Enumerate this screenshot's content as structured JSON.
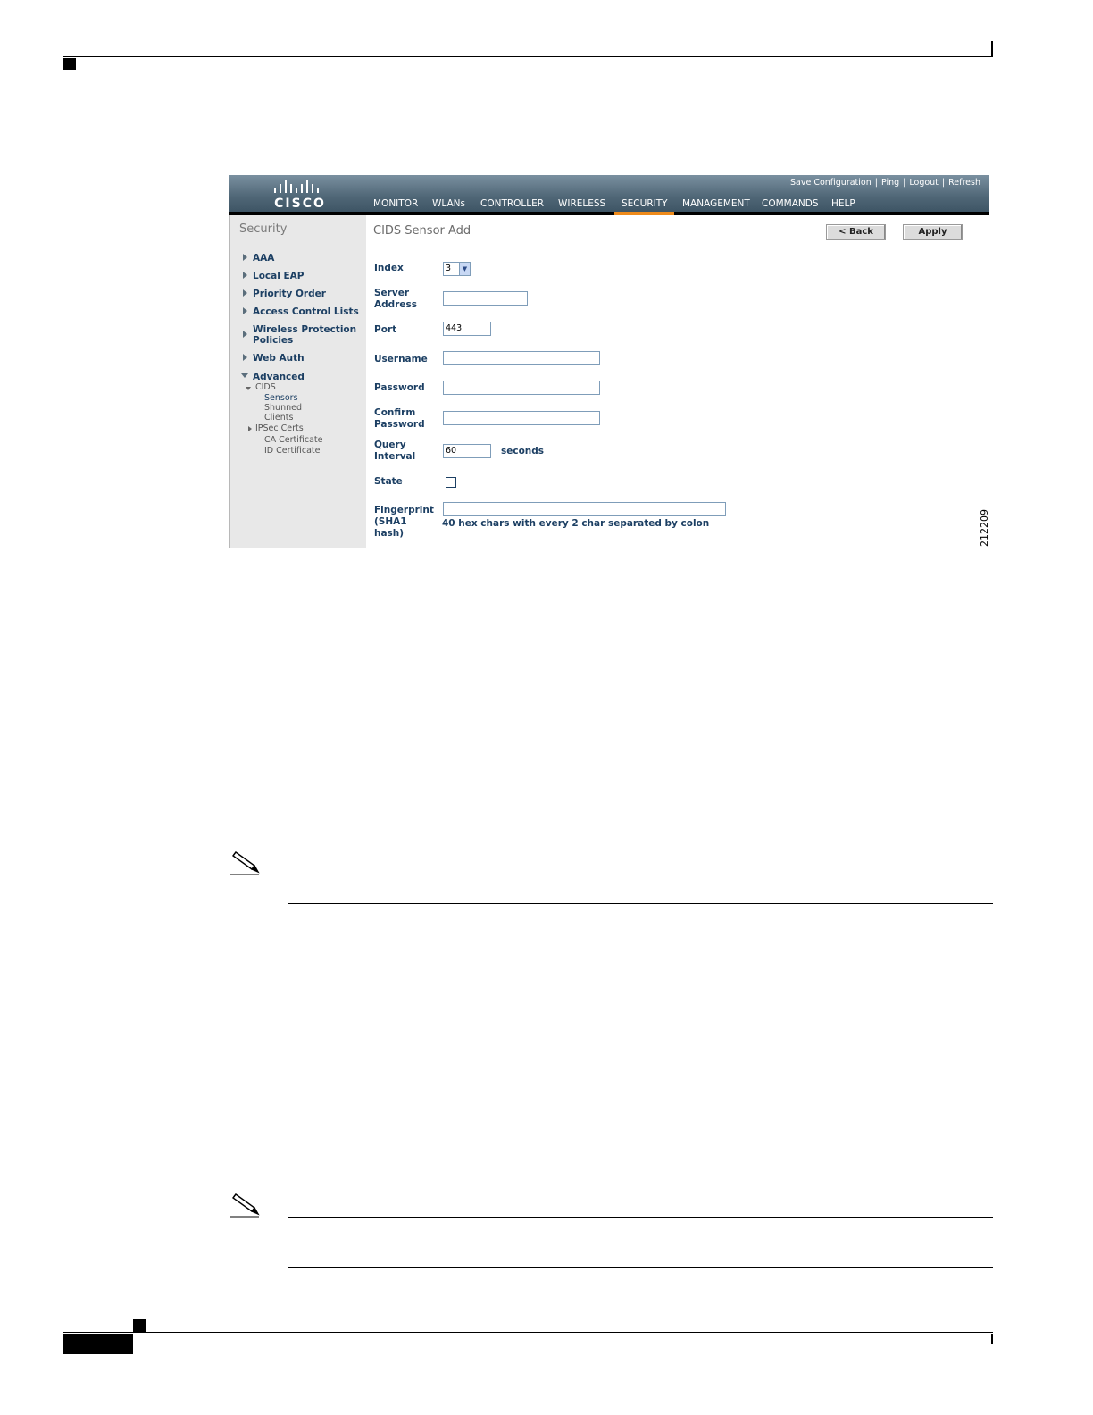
{
  "figure_id": "212209",
  "screenshot": {
    "utility_links": [
      "Save Configuration",
      "Ping",
      "Logout",
      "Refresh"
    ],
    "logo_text": "CISCO",
    "nav": [
      "MONITOR",
      "WLANs",
      "CONTROLLER",
      "WIRELESS",
      "SECURITY",
      "MANAGEMENT",
      "COMMANDS",
      "HELP"
    ],
    "active_nav": "SECURITY",
    "colors": {
      "accent": "#ee8a1a",
      "header": "#4f6676",
      "link": "#1c3f63"
    },
    "sidebar": {
      "title": "Security",
      "items": [
        "AAA",
        "Local EAP",
        "Priority Order",
        "Access Control Lists",
        "Wireless Protection",
        "Policies",
        "Web Auth",
        "Advanced"
      ],
      "sub_cids": "CIDS",
      "sub_cids_items": [
        "Sensors",
        "Shunned",
        "Clients"
      ],
      "sub_ipsec": "IPSec Certs",
      "sub_ipsec_items": [
        "CA Certificate",
        "ID Certificate"
      ]
    },
    "page_title": "CIDS Sensor Add",
    "buttons": {
      "back": "< Back",
      "apply": "Apply"
    },
    "form": {
      "index_label": "Index",
      "index_value": "3",
      "server_label_1": "Server",
      "server_label_2": "Address",
      "server_value": "",
      "port_label": "Port",
      "port_value": "443",
      "username_label": "Username",
      "username_value": "",
      "password_label": "Password",
      "password_value": "",
      "confirm_label_1": "Confirm",
      "confirm_label_2": "Password",
      "confirm_value": "",
      "query_label_1": "Query",
      "query_label_2": "Interval",
      "query_value": "60",
      "query_unit": "seconds",
      "state_label": "State",
      "state_checked": false,
      "fp_label_1": "Fingerprint",
      "fp_label_2": "(SHA1",
      "fp_label_3": "hash)",
      "fp_value": "",
      "fp_hint": "40 hex chars with every 2 char separated by colon"
    }
  }
}
